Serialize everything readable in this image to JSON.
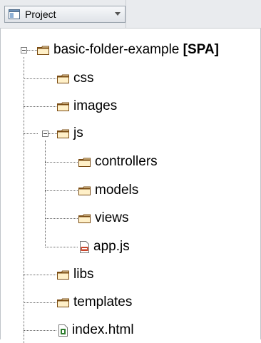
{
  "header": {
    "project_label": "Project"
  },
  "tree": {
    "root": {
      "label": "basic-folder-example",
      "badge": "[SPA]",
      "icon": "folder-icon",
      "expanded": true
    },
    "items": [
      {
        "label": "css",
        "icon": "folder-icon"
      },
      {
        "label": "images",
        "icon": "folder-icon"
      },
      {
        "label": "js",
        "icon": "folder-icon",
        "expanded": true
      },
      {
        "label": "controllers",
        "icon": "folder-icon"
      },
      {
        "label": "models",
        "icon": "folder-icon"
      },
      {
        "label": "views",
        "icon": "folder-icon"
      },
      {
        "label": "app.js",
        "icon": "js-file-icon"
      },
      {
        "label": "libs",
        "icon": "folder-icon"
      },
      {
        "label": "templates",
        "icon": "folder-icon"
      },
      {
        "label": "index.html",
        "icon": "html-file-icon"
      }
    ]
  },
  "colors": {
    "folder_outline": "#7a4b12",
    "folder_fill": "#fff0c8",
    "js_file_accent": "#c8442a",
    "html_file_accent": "#2e7d2e"
  }
}
